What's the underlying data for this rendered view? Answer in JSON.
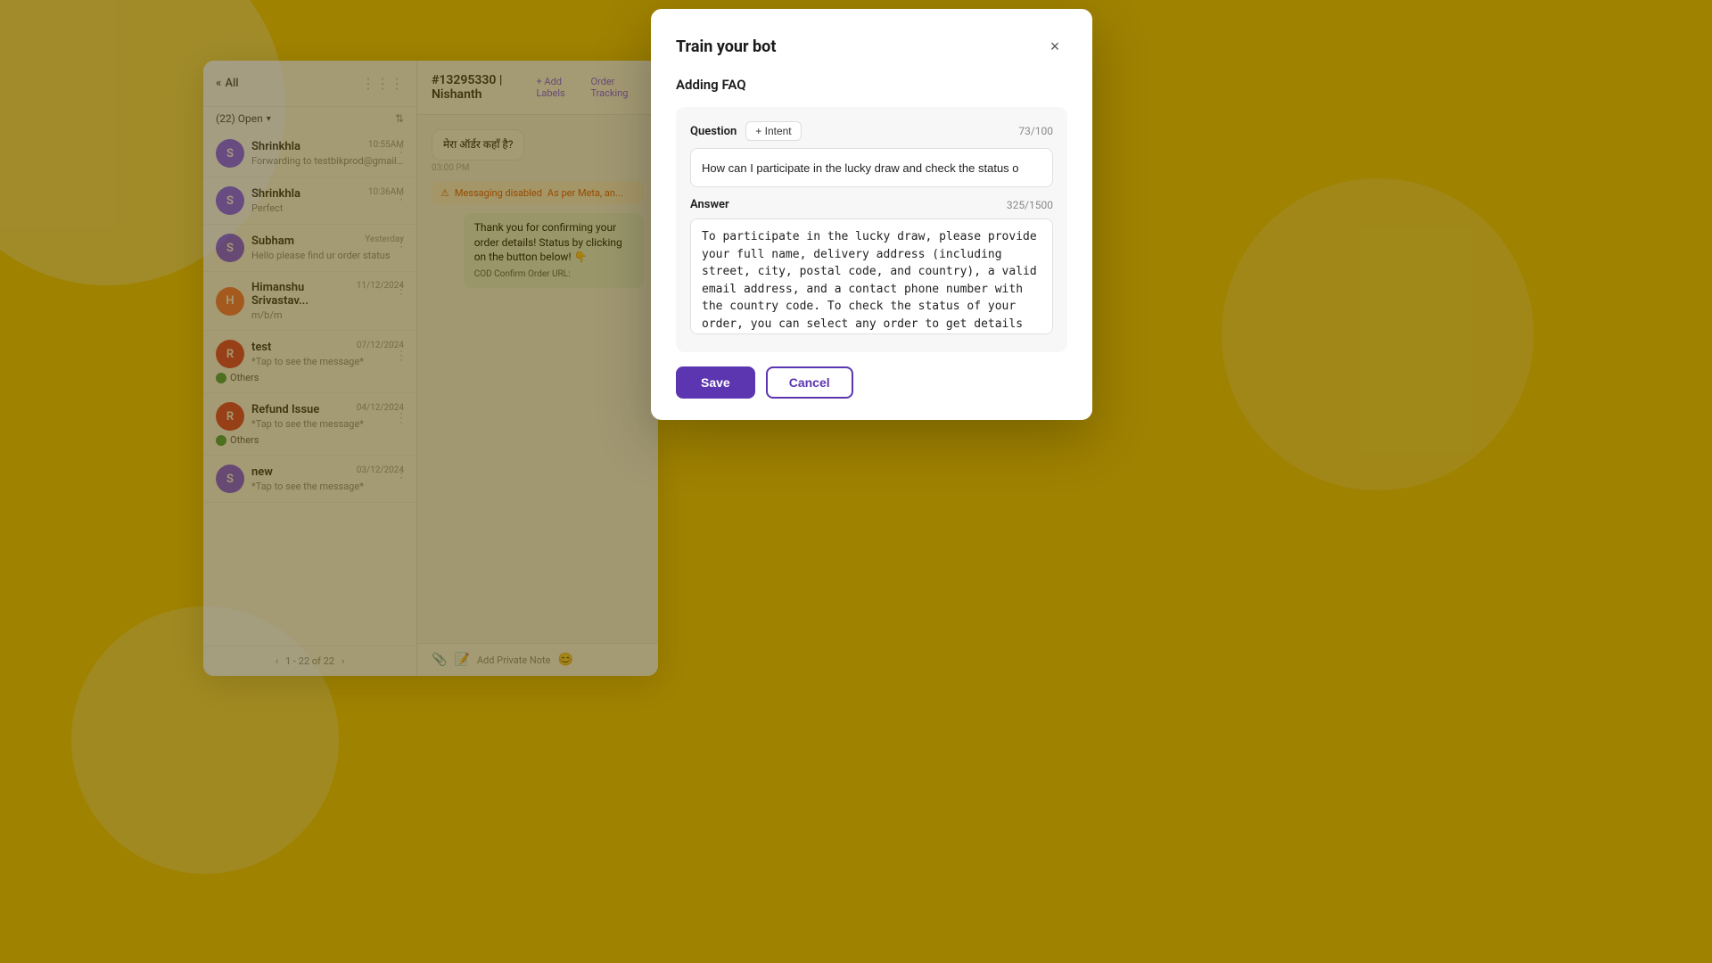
{
  "background": {
    "color": "#f5c800"
  },
  "sidebar": {
    "back_label": "All",
    "open_count": "(22) Open",
    "items": [
      {
        "id": "shrinkhla-1",
        "avatar_letter": "S",
        "avatar_class": "avatar-s",
        "name": "Shrinkhla",
        "time": "10:55AM",
        "preview": "Forwarding to testbikprod@gmail.com",
        "tag": null
      },
      {
        "id": "shrinkhla-2",
        "avatar_letter": "S",
        "avatar_class": "avatar-s",
        "name": "Shrinkhla",
        "time": "10:36AM",
        "preview": "Perfect",
        "tag": null
      },
      {
        "id": "subham",
        "avatar_letter": "S",
        "avatar_class": "avatar-s",
        "name": "Subham",
        "time": "Yesterday",
        "preview": "Hello please find ur order status",
        "tag": null
      },
      {
        "id": "himanshu",
        "avatar_letter": "H",
        "avatar_class": "avatar-h",
        "name": "Himanshu Srivastav...",
        "time": "11/12/2024",
        "preview": "m/b/m",
        "tag": null
      },
      {
        "id": "test",
        "avatar_letter": "R",
        "avatar_class": "avatar-r",
        "name": "test",
        "time": "07/12/2024",
        "preview": "*Tap to see the message*",
        "tag": "Others"
      },
      {
        "id": "refund-issue",
        "avatar_letter": "R",
        "avatar_class": "avatar-r",
        "name": "Refund Issue",
        "time": "04/12/2024",
        "preview": "*Tap to see the message*",
        "tag": "Others"
      },
      {
        "id": "new",
        "avatar_letter": "S",
        "avatar_class": "avatar-s",
        "name": "new",
        "time": "03/12/2024",
        "preview": "*Tap to see the message*",
        "tag": null
      }
    ],
    "footer_pagination": "1 - 22 of 22"
  },
  "chat": {
    "title": "#13295330 | Nishanth",
    "add_labels": "+ Add Labels",
    "order_tracking": "Order Tracking",
    "messages": [
      {
        "type": "incoming",
        "text": "मेरा ऑर्डर कहाँ है?",
        "time": "03:00 PM"
      },
      {
        "type": "warning",
        "text": "Messaging disabled",
        "subtext": "As per Meta, an..."
      },
      {
        "type": "outgoing",
        "text": "Thank you for confirming your order details! Status by clicking on the button below! 👇",
        "subtext": "COD Confirm Order URL:"
      }
    ],
    "add_private_note": "Add Private Note"
  },
  "modal": {
    "title": "Train your bot",
    "close_label": "×",
    "subtitle": "Adding FAQ",
    "question_label": "Question",
    "intent_label": "+ Intent",
    "question_count": "73/100",
    "question_value": "How can I participate in the lucky draw and check the status o",
    "answer_label": "Answer",
    "answer_count": "325/1500",
    "answer_value": "To participate in the lucky draw, please provide your full name, delivery address (including street, city, postal code, and country), a valid email address, and a contact phone number with the country code. To check the status of your order, you can select any order to get details or contact our support team for assistance.",
    "save_label": "Save",
    "cancel_label": "Cancel"
  }
}
